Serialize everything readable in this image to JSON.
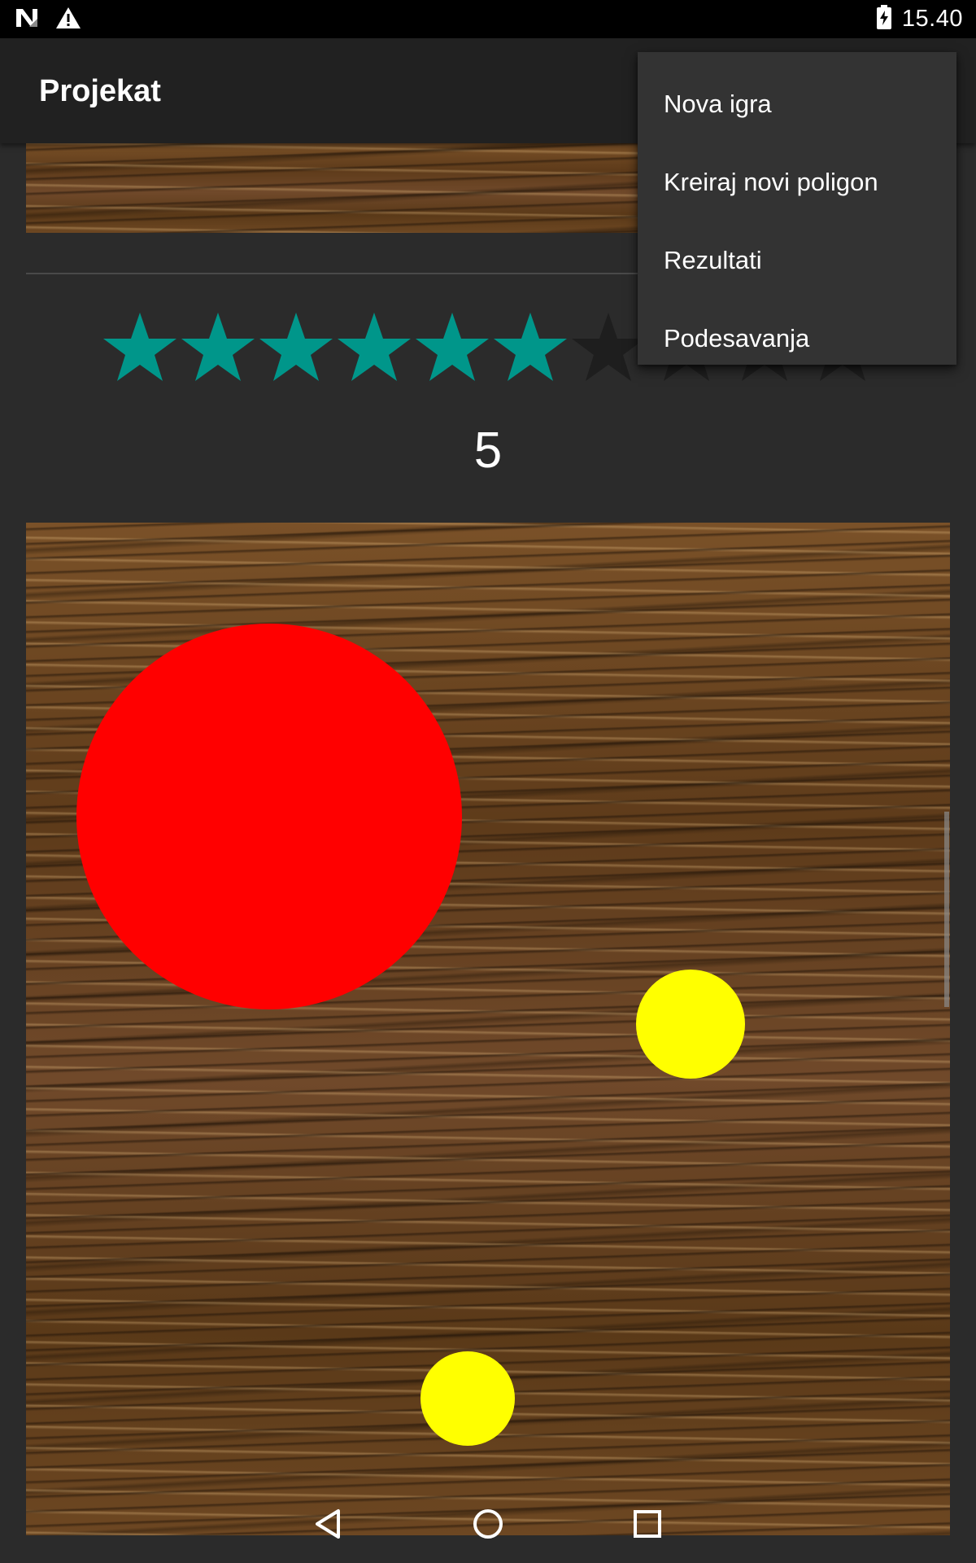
{
  "status_bar": {
    "time": "15.40",
    "icons": [
      "n-logo-icon",
      "warning-icon",
      "battery-charging-icon"
    ]
  },
  "app_bar": {
    "title": "Projekat"
  },
  "menu": {
    "items": [
      {
        "label": "Nova igra"
      },
      {
        "label": "Kreiraj novi poligon"
      },
      {
        "label": "Rezultati"
      },
      {
        "label": "Podesavanja"
      }
    ]
  },
  "rating": {
    "filled": 6,
    "total": 10,
    "filled_color": "#00968a",
    "empty_color": "#1e1e1e"
  },
  "score": "5",
  "colors": {
    "red_ball": "#ff0000",
    "yellow_ball": "#ffff00",
    "background": "#2b2b2b",
    "app_bar": "#212121"
  },
  "nav_bar": {
    "icons": [
      "back-icon",
      "home-icon",
      "recents-icon"
    ]
  }
}
